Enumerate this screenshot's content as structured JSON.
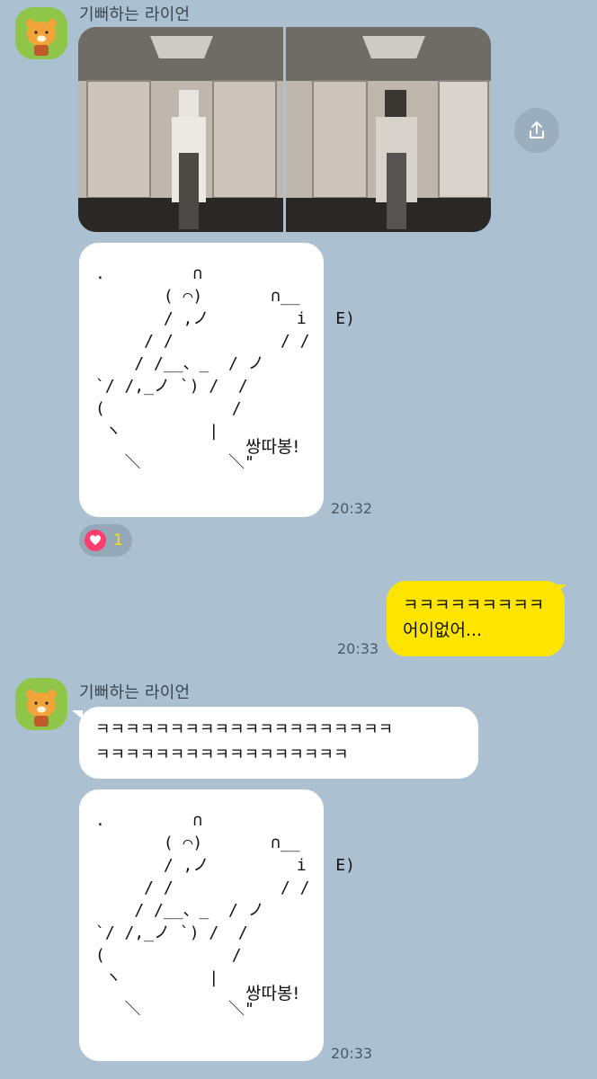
{
  "messages": [
    {
      "sender": "기뻐하는 라이언",
      "avatar_icon": "ryan-lion-avatar-icon",
      "photos": [
        "photo-left",
        "photo-right"
      ],
      "ascii_art": ".         ∩\n       ( ⌒)       ∩__\n       / ,ノ         i   E)\n     / /           / /\n    / /__、_  / ノ\n`/ /,_ノ `) /  /\n(             /\n ヽ         |",
      "ascii_tail": "   ＼         ＼\"",
      "caption": "쌍따봉!",
      "time": "20:32",
      "reaction_count": "1"
    },
    {
      "text": "ㅋㅋㅋㅋㅋㅋㅋㅋㅋ\n어이없어...",
      "time": "20:33"
    },
    {
      "sender": "기뻐하는 라이언",
      "text": "ㅋㅋㅋㅋㅋㅋㅋㅋㅋㅋㅋㅋㅋㅋㅋㅋㅋㅋㅋㅋ\nㅋㅋㅋㅋㅋㅋㅋㅋㅋㅋㅋㅋㅋㅋㅋㅋㅋ",
      "ascii_art": ".         ∩\n       ( ⌒)       ∩__\n       / ,ノ         i   E)\n     / /           / /\n    / /__、_  / ノ\n`/ /,_ノ `) /  /\n(             /\n ヽ         |",
      "ascii_tail": "   ＼         ＼\"",
      "caption": "쌍따봉!",
      "time": "20:33"
    }
  ],
  "colors": {
    "background": "#abc1d1",
    "my_bubble": "#fee500",
    "their_bubble": "#ffffff",
    "reaction_heart": "#ff3d6e",
    "reaction_count": "#ffe100"
  }
}
